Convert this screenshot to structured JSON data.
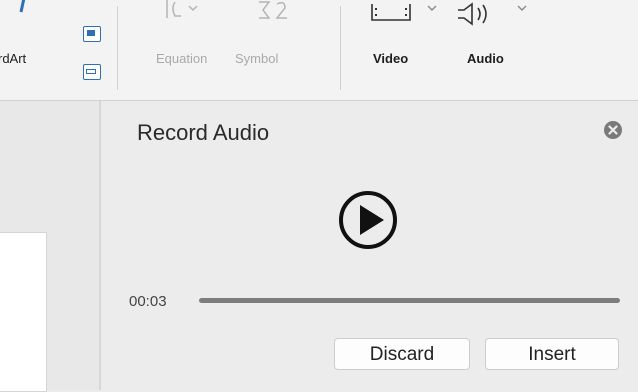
{
  "ribbon": {
    "wordart_label": "rdArt",
    "equation_label": "Equation",
    "symbol_label": "Symbol",
    "video_label": "Video",
    "audio_label": "Audio",
    "icons": [
      "wordart-icon",
      "text-box-icon",
      "object-icon",
      "equation-icon",
      "symbol-icon",
      "video-icon",
      "audio-icon"
    ]
  },
  "panel": {
    "title": "Record Audio",
    "elapsed_time": "00:03",
    "progress": 1.0,
    "discard_label": "Discard",
    "insert_label": "Insert"
  },
  "colors": {
    "accent": "#2f6fb3",
    "panel_bg": "#ececec",
    "play_icon": "#111111",
    "close_icon_bg": "#7a7a7a",
    "disabled_text": "#a9a9a9"
  }
}
